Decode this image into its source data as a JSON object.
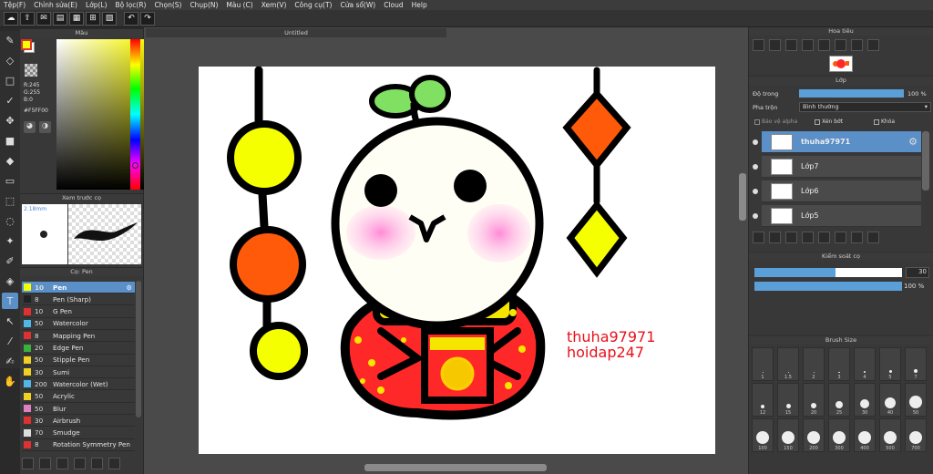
{
  "menu": [
    "Tệp(F)",
    "Chỉnh sửa(E)",
    "Lớp(L)",
    "Bộ lọc(R)",
    "Chọn(S)",
    "Chụp(N)",
    "Màu (C)",
    "Xem(V)",
    "Công cụ(T)",
    "Cửa sổ(W)",
    "Cloud",
    "Help"
  ],
  "color_panel": {
    "title": "Màu",
    "r": "R:245",
    "g": "G:255",
    "b": "B:0",
    "hex": "#F5FF00",
    "fg": "#f5ff00",
    "bg": "#ffffff"
  },
  "preview": {
    "title": "Xem trước cọ",
    "size": "2.18mm"
  },
  "brushes": {
    "title": "Cọ: Pen",
    "items": [
      {
        "size": "10",
        "name": "Pen",
        "color": "#f5ff00"
      },
      {
        "size": "8",
        "name": "Pen (Sharp)",
        "color": "#222222"
      },
      {
        "size": "10",
        "name": "G Pen",
        "color": "#e03030"
      },
      {
        "size": "50",
        "name": "Watercolor",
        "color": "#4fb8e6"
      },
      {
        "size": "8",
        "name": "Mapping Pen",
        "color": "#e03030"
      },
      {
        "size": "20",
        "name": "Edge Pen",
        "color": "#3ab13a"
      },
      {
        "size": "50",
        "name": "Stipple Pen",
        "color": "#f0d020"
      },
      {
        "size": "30",
        "name": "Sumi",
        "color": "#f0d020"
      },
      {
        "size": "200",
        "name": "Watercolor (Wet)",
        "color": "#4fb8e6"
      },
      {
        "size": "50",
        "name": "Acrylic",
        "color": "#f0d020"
      },
      {
        "size": "50",
        "name": "Blur",
        "color": "#e080c0"
      },
      {
        "size": "30",
        "name": "Airbrush",
        "color": "#e03030"
      },
      {
        "size": "70",
        "name": "Smudge",
        "color": "#dddddd"
      },
      {
        "size": "8",
        "name": "Rotation Symmetry Pen",
        "color": "#e03030"
      }
    ]
  },
  "document": {
    "tab": "Untitled",
    "watermark_line1": "thuha97971",
    "watermark_line2": "hoidap247",
    "watermark_color": "#e8101a"
  },
  "navigator": {
    "title": "Hoa tiêu"
  },
  "layers": {
    "title": "Lớp",
    "opacity_label": "Độ trong",
    "opacity_value": "100 %",
    "opacity": 1.0,
    "blend_label": "Pha trộn",
    "blend_value": "Bình thường",
    "protect_alpha": "Bảo vệ alpha",
    "clipping": "Xén bớt",
    "lock": "Khóa",
    "items": [
      "thuha97971",
      "Lớp7",
      "Lớp6",
      "Lớp5"
    ]
  },
  "brush_control": {
    "title": "Kiểm soát cọ",
    "size_value": "30",
    "opacity_value": "100 %",
    "size_fraction": 0.55,
    "opacity_fraction": 1.0
  },
  "brush_size": {
    "title": "Brush Size",
    "labels": [
      "1",
      "1.5",
      "2",
      "3",
      "4",
      "5",
      "7",
      "12",
      "15",
      "20",
      "25",
      "30",
      "40",
      "50",
      "100",
      "150",
      "200",
      "300",
      "400",
      "500",
      "700"
    ]
  }
}
